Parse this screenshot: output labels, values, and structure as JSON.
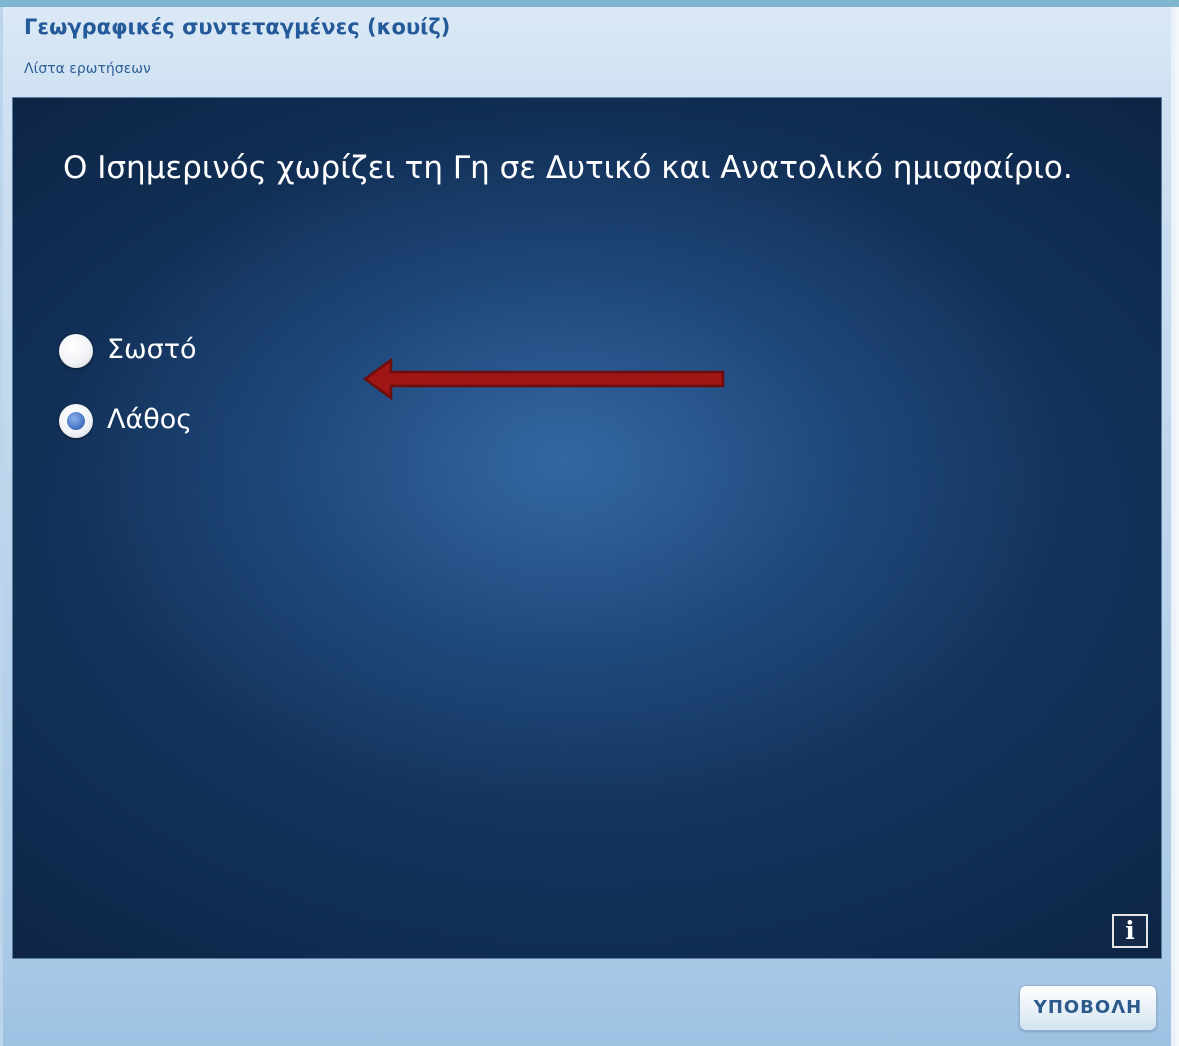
{
  "header": {
    "title": "Γεωγραφικές συντεταγμένες (κουίζ)",
    "question_list_link": "Λίστα ερωτήσεων"
  },
  "question": {
    "text": "Ο Ισημερινός χωρίζει τη Γη σε Δυτικό και Ανατολικό ημισφαίριο.",
    "options": [
      {
        "label": "Σωστό",
        "selected": false
      },
      {
        "label": "Λάθος",
        "selected": true
      }
    ]
  },
  "controls": {
    "info_label": "i",
    "submit_label": "ΥΠΟΒΟΛΗ"
  },
  "colors": {
    "accent": "#24599a",
    "arrow": "#a01515",
    "radio_selected": "#4c79c6",
    "slide_background": "#1c4373"
  },
  "icons": {
    "arrow": "left-arrow-icon",
    "info": "info-icon"
  }
}
